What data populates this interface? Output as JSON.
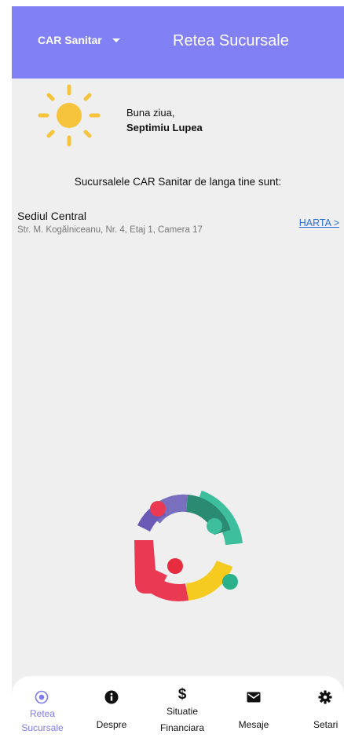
{
  "header": {
    "org_selector": "CAR Sanitar",
    "title": "Retea Sucursale"
  },
  "greeting": {
    "line1": "Buna ziua,",
    "name": "Septimiu Lupea"
  },
  "intro_text": "Sucursalele CAR Sanitar de langa tine sunt:",
  "branches": [
    {
      "name": "Sediul Central",
      "address": "Str. M. Kogălniceanu, Nr. 4, Etaj 1, Camera 17",
      "map_link": "HARTA >"
    }
  ],
  "bottom_nav": {
    "items": [
      {
        "label_line1": "Retea",
        "label_line2": "Sucursale",
        "icon": "radio-target-icon",
        "active": true
      },
      {
        "label_line1": "Despre",
        "icon": "info-icon",
        "active": false
      },
      {
        "label_line1": "Situatie",
        "label_line2": "Financiara",
        "icon": "dollar-icon",
        "active": false
      },
      {
        "label_line1": "Mesaje",
        "icon": "envelope-icon",
        "active": false
      },
      {
        "label_line1": "Setari",
        "icon": "gear-icon",
        "active": false
      }
    ]
  },
  "colors": {
    "header": "#8280f5",
    "active_nav": "#7d7bf0",
    "link": "#2a6fd8",
    "sun": "#f6c33c"
  }
}
